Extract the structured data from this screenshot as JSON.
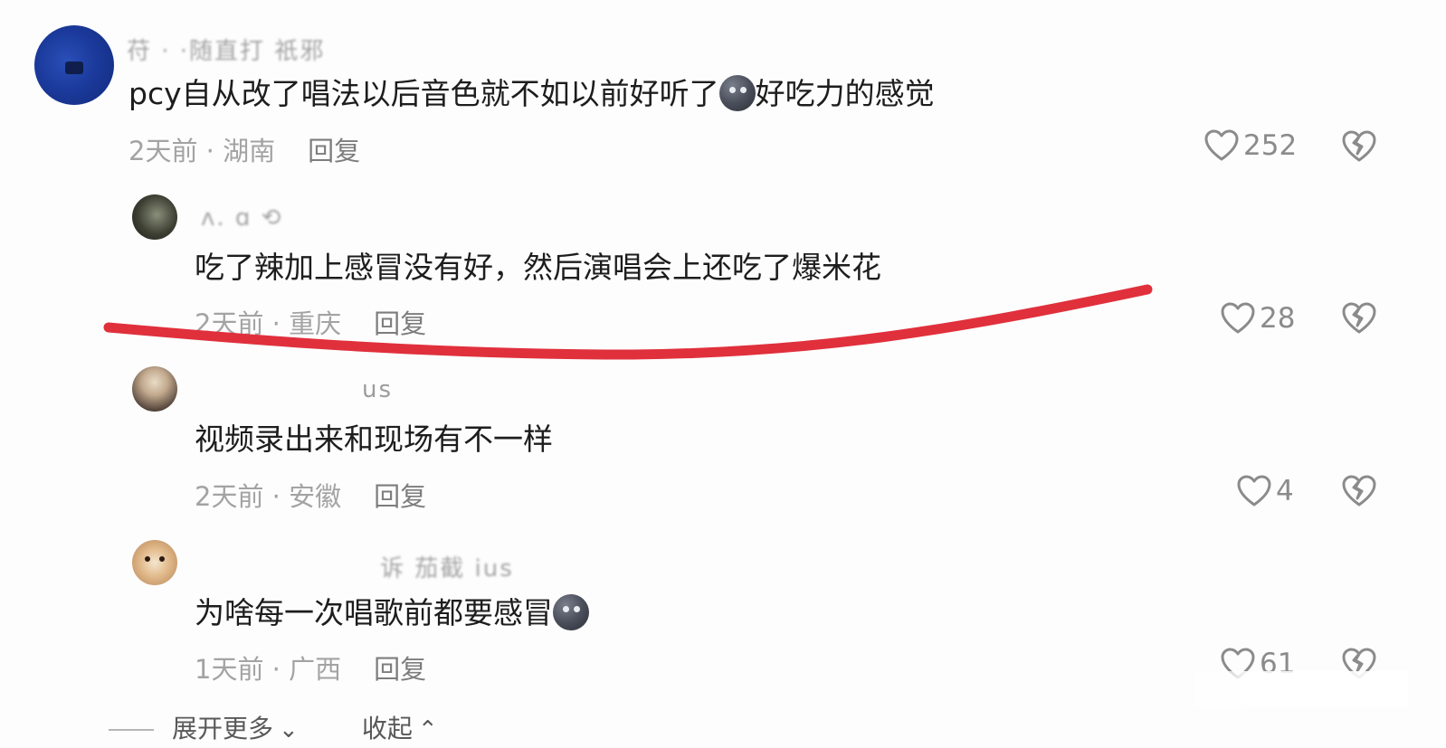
{
  "comments": [
    {
      "username": "苻 · ·随直打 祇邪",
      "text_before_emoji": "pcy自从改了唱法以后音色就不如以前好听了",
      "text_after_emoji": "好吃力的感觉",
      "time": "2天前",
      "location": "湖南",
      "reply_label": "回复",
      "likes": "252"
    },
    {
      "username": "ᴧ. ɑ  ⟲",
      "text": "吃了辣加上感冒没有好，然后演唱会上还吃了爆米花",
      "time": "2天前",
      "location": "重庆",
      "reply_label": "回复",
      "likes": "28"
    },
    {
      "username": "us",
      "text": "视频录出来和现场有不一样",
      "time": "2天前",
      "location": "安徽",
      "reply_label": "回复",
      "likes": "4"
    },
    {
      "username": "诉 茄截 ius",
      "text_before_emoji": "为啥每一次唱歌前都要感冒",
      "time": "1天前",
      "location": "广西",
      "reply_label": "回复",
      "likes": "61"
    }
  ],
  "meta_separator": " · ",
  "bottom": {
    "expand_label": "展开更多",
    "collapse_label": "收起"
  },
  "colors": {
    "annotation_stroke": "#e0303c",
    "text": "#1d1d1d",
    "meta": "#a3a3a3"
  },
  "icons": [
    "heart-outline-icon",
    "broken-heart-icon",
    "moon-face-emoji",
    "chevron-down-icon",
    "chevron-up-icon"
  ]
}
